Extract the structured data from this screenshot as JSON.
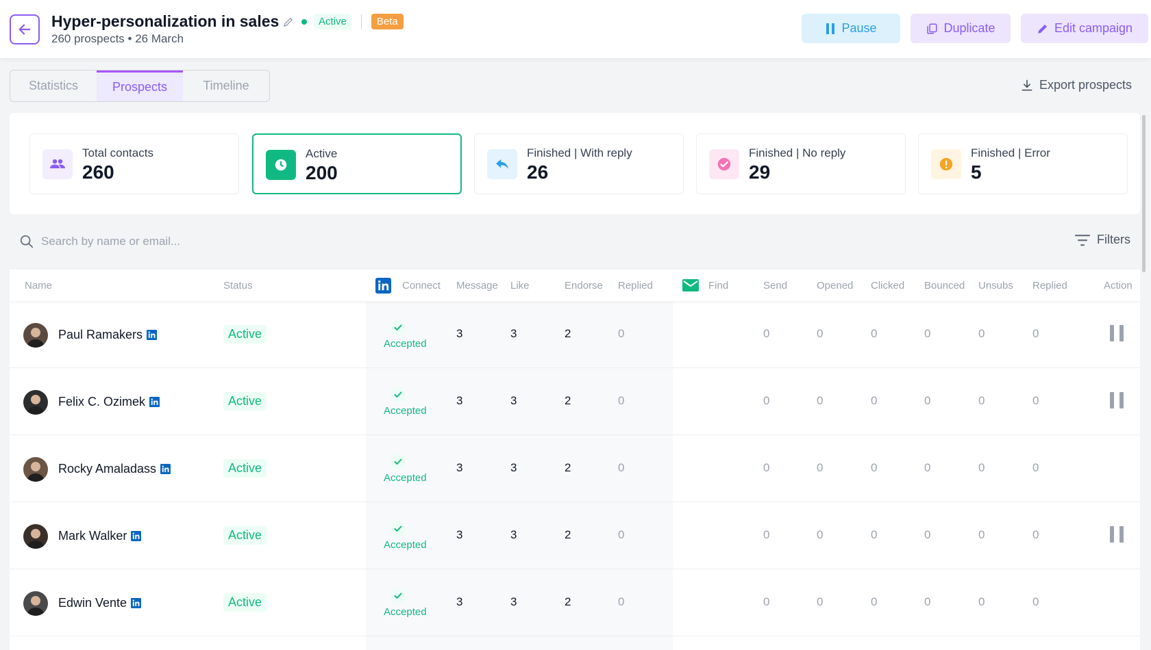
{
  "header": {
    "title": "Hyper-personalization in sales",
    "status": "Active",
    "badge": "Beta",
    "subtitle": "260 prospects • 26 March",
    "pause_label": "Pause",
    "duplicate_label": "Duplicate",
    "edit_label": "Edit campaign"
  },
  "tabs": [
    {
      "label": "Statistics",
      "active": false
    },
    {
      "label": "Prospects",
      "active": true
    },
    {
      "label": "Timeline",
      "active": false
    }
  ],
  "export_label": "Export prospects",
  "stats": [
    {
      "label": "Total contacts",
      "value": "260",
      "icon": "users-icon"
    },
    {
      "label": "Active",
      "value": "200",
      "icon": "clock-icon"
    },
    {
      "label": "Finished | With reply",
      "value": "26",
      "icon": "reply-icon"
    },
    {
      "label": "Finished | No reply",
      "value": "29",
      "icon": "check-circle-icon"
    },
    {
      "label": "Finished | Error",
      "value": "5",
      "icon": "warning-icon"
    }
  ],
  "search": {
    "placeholder": "Search by name or email..."
  },
  "filters_label": "Filters",
  "columns": {
    "name": "Name",
    "status": "Status",
    "connect": "Connect",
    "message": "Message",
    "like": "Like",
    "endorse": "Endorse",
    "li_replied": "Replied",
    "find": "Find",
    "send": "Send",
    "opened": "Opened",
    "clicked": "Clicked",
    "bounced": "Bounced",
    "unsubs": "Unsubs",
    "em_replied": "Replied",
    "action": "Action"
  },
  "rows": [
    {
      "name": "Paul Ramakers",
      "status": "Active",
      "connect": "Accepted",
      "message": "3",
      "like": "3",
      "endorse": "2",
      "li_replied": "0",
      "send": "0",
      "opened": "0",
      "clicked": "0",
      "bounced": "0",
      "unsubs": "0",
      "em_replied": "0",
      "has_action": true
    },
    {
      "name": "Felix C. Ozimek",
      "status": "Active",
      "connect": "Accepted",
      "message": "3",
      "like": "3",
      "endorse": "2",
      "li_replied": "0",
      "send": "0",
      "opened": "0",
      "clicked": "0",
      "bounced": "0",
      "unsubs": "0",
      "em_replied": "0",
      "has_action": true
    },
    {
      "name": "Rocky Amaladass",
      "status": "Active",
      "connect": "Accepted",
      "message": "3",
      "like": "3",
      "endorse": "2",
      "li_replied": "0",
      "send": "0",
      "opened": "0",
      "clicked": "0",
      "bounced": "0",
      "unsubs": "0",
      "em_replied": "0",
      "has_action": false
    },
    {
      "name": "Mark Walker",
      "status": "Active",
      "connect": "Accepted",
      "message": "3",
      "like": "3",
      "endorse": "2",
      "li_replied": "0",
      "send": "0",
      "opened": "0",
      "clicked": "0",
      "bounced": "0",
      "unsubs": "0",
      "em_replied": "0",
      "has_action": true
    },
    {
      "name": "Edwin Vente",
      "status": "Active",
      "connect": "Accepted",
      "message": "3",
      "like": "3",
      "endorse": "2",
      "li_replied": "0",
      "send": "0",
      "opened": "0",
      "clicked": "0",
      "bounced": "0",
      "unsubs": "0",
      "em_replied": "0",
      "has_action": false
    }
  ],
  "colors": {
    "accent": "#8b5cf6",
    "success": "#10b981",
    "info": "#2b9fe6",
    "warning": "#f59e42",
    "linkedin": "#0a66c2"
  }
}
